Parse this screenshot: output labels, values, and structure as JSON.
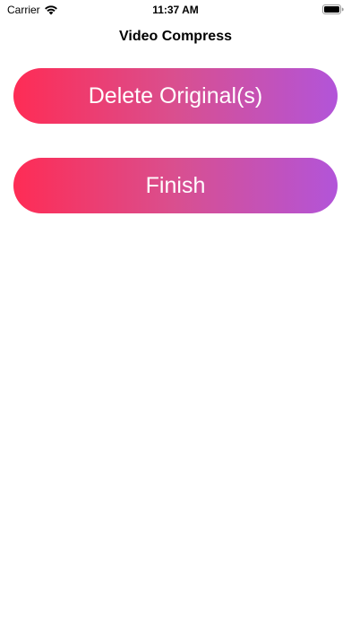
{
  "status_bar": {
    "carrier": "Carrier",
    "time": "11:37 AM",
    "icons": [
      "wifi-icon",
      "battery-icon"
    ]
  },
  "nav": {
    "title": "Video Compress"
  },
  "actions": {
    "delete_label": "Delete Original(s)",
    "finish_label": "Finish"
  },
  "colors": {
    "gradient_start": "#fe2c55",
    "gradient_mid": "#d94f8f",
    "gradient_end": "#b254d9",
    "button_text": "#ffffff",
    "background": "#ffffff"
  }
}
